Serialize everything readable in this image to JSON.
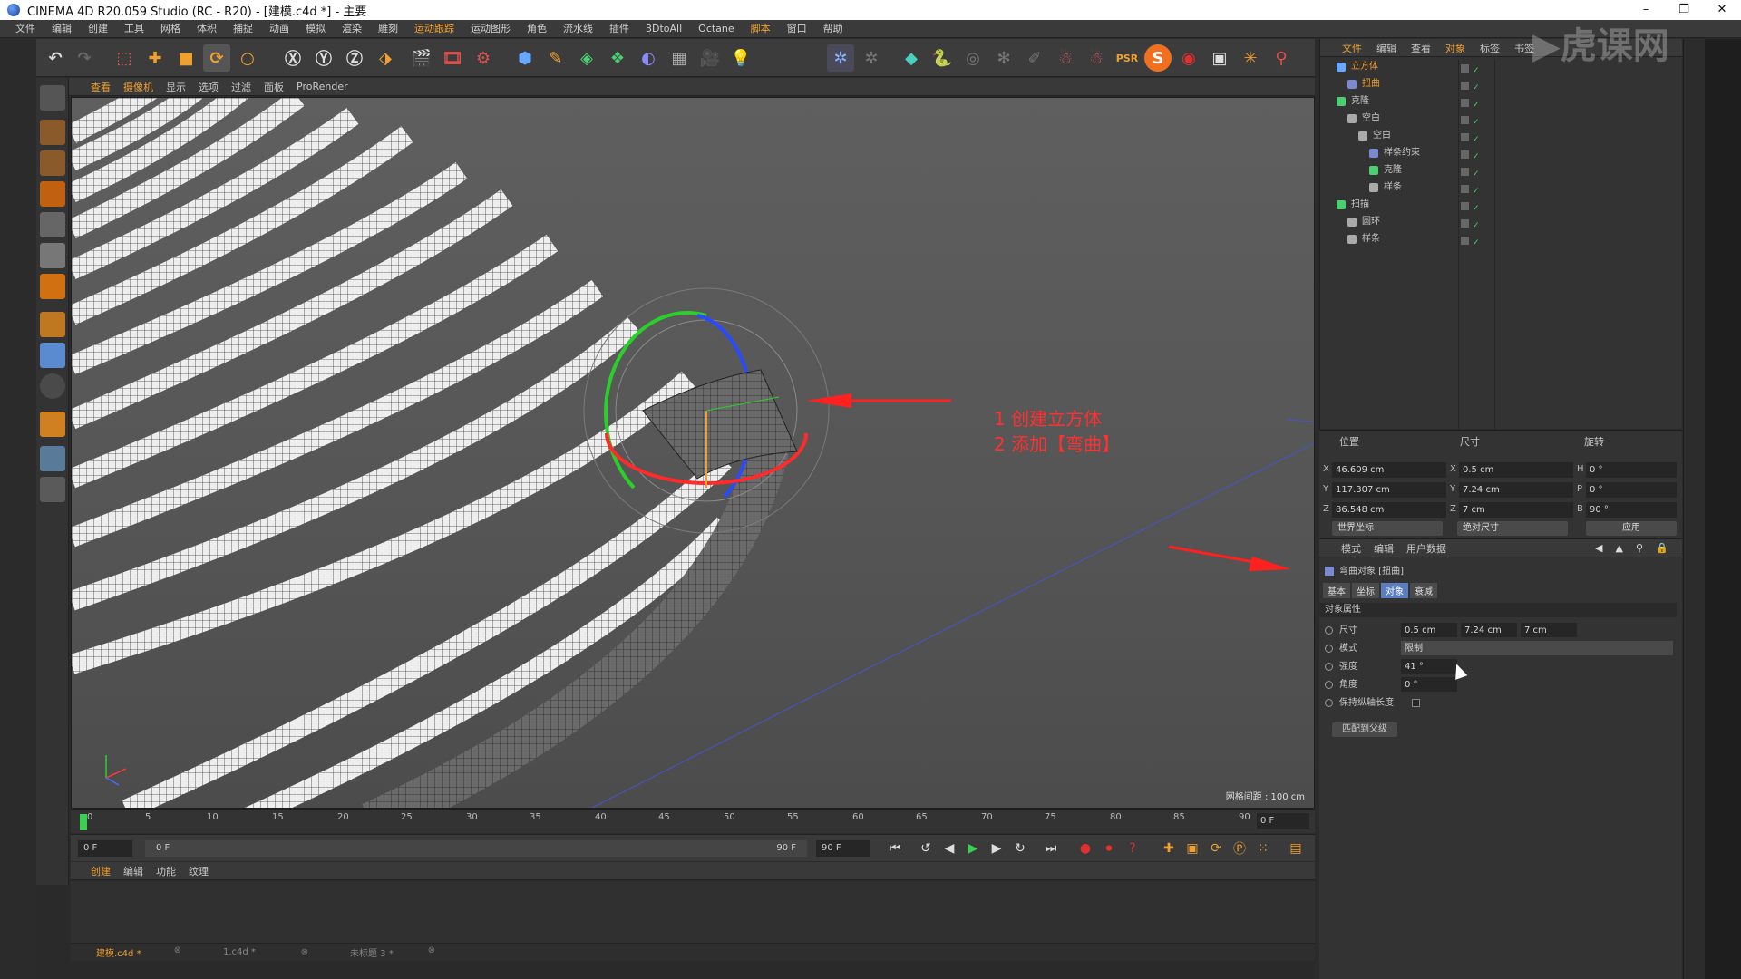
{
  "window": {
    "title": "CINEMA 4D R20.059 Studio (RC - R20) - [建模.c4d *] - 主要",
    "controls": [
      "–",
      "❐",
      "✕"
    ]
  },
  "menu": [
    "文件",
    "编辑",
    "创建",
    "工具",
    "网格",
    "体积",
    "捕捉",
    "动画",
    "模拟",
    "渲染",
    "雕刻",
    "运动跟踪",
    "运动图形",
    "角色",
    "流水线",
    "插件",
    "3DtoAll",
    "Octane",
    "脚本",
    "窗口",
    "帮助"
  ],
  "viewport": {
    "menu": [
      "查看",
      "摄像机",
      "显示",
      "选项",
      "过滤",
      "面板",
      "ProRender"
    ],
    "grid_label": "网格间距 : 100 cm",
    "annotation_line1": "1 创建立方体",
    "annotation_line2": "2 添加【弯曲】"
  },
  "timeline": {
    "ticks": [
      "0",
      "5",
      "10",
      "15",
      "20",
      "25",
      "30",
      "35",
      "40",
      "45",
      "50",
      "55",
      "60",
      "65",
      "70",
      "75",
      "80",
      "85",
      "90"
    ],
    "current_frame": "0 F"
  },
  "playbar": {
    "start": "0 F",
    "range_start": "0 F",
    "range_end": "90 F",
    "end": "90 F"
  },
  "material_panel": {
    "menu": [
      "创建",
      "编辑",
      "功能",
      "纹理"
    ]
  },
  "file_tabs": [
    {
      "label": "建模.c4d *"
    },
    {
      "label": "1.c4d *"
    },
    {
      "label": "未标题 3 *"
    }
  ],
  "object_manager": {
    "menu": [
      "文件",
      "编辑",
      "查看",
      "对象",
      "标签",
      "书签"
    ],
    "tree": [
      {
        "label": "立方体",
        "indent": 0,
        "color": "#f0a030",
        "icon": "cube-icon",
        "selected": true
      },
      {
        "label": "扭曲",
        "indent": 1,
        "color": "#f0a030",
        "icon": "bend-deformer-icon",
        "selected": true
      },
      {
        "label": "克隆",
        "indent": 0,
        "color": "#c8c8c8",
        "icon": "cloner-icon"
      },
      {
        "label": "空白",
        "indent": 1,
        "color": "#c8c8c8",
        "icon": "null-icon"
      },
      {
        "label": "空白",
        "indent": 2,
        "color": "#c8c8c8",
        "icon": "null-icon"
      },
      {
        "label": "样条约束",
        "indent": 3,
        "color": "#c8c8c8",
        "icon": "spline-wrap-icon"
      },
      {
        "label": "克隆",
        "indent": 3,
        "color": "#c8c8c8",
        "icon": "cloner-icon"
      },
      {
        "label": "样条",
        "indent": 3,
        "color": "#c8c8c8",
        "icon": "spline-icon"
      },
      {
        "label": "扫描",
        "indent": 0,
        "color": "#c8c8c8",
        "icon": "sweep-icon"
      },
      {
        "label": "圆环",
        "indent": 1,
        "color": "#c8c8c8",
        "icon": "circle-icon"
      },
      {
        "label": "样条",
        "indent": 1,
        "color": "#c8c8c8",
        "icon": "spline-icon"
      }
    ]
  },
  "coordinates": {
    "headers": {
      "position": "位置",
      "size": "尺寸",
      "rotation": "旋转"
    },
    "rows": [
      {
        "axis": "X",
        "pos": "46.609 cm",
        "size_axis": "X",
        "size": "0.5 cm",
        "rot_axis": "H",
        "rot": "0 °"
      },
      {
        "axis": "Y",
        "pos": "117.307 cm",
        "size_axis": "Y",
        "size": "7.24 cm",
        "rot_axis": "P",
        "rot": "0 °"
      },
      {
        "axis": "Z",
        "pos": "86.548 cm",
        "size_axis": "Z",
        "size": "7 cm",
        "rot_axis": "B",
        "rot": "90 °"
      }
    ],
    "coord_mode": "世界坐标",
    "size_mode": "绝对尺寸",
    "apply": "应用"
  },
  "attributes": {
    "menu": [
      "模式",
      "编辑",
      "用户数据"
    ],
    "object_title": "弯曲对象 [扭曲]",
    "tabs": [
      {
        "label": "基本",
        "active": false
      },
      {
        "label": "坐标",
        "active": false
      },
      {
        "label": "对象",
        "active": true
      },
      {
        "label": "衰减",
        "active": false
      }
    ],
    "section": "对象属性",
    "size_label": "尺寸",
    "size_x": "0.5 cm",
    "size_y": "7.24 cm",
    "size_z": "7 cm",
    "mode_label": "模式",
    "mode_value": "限制",
    "strength_label": "强度",
    "strength_value": "41 °",
    "angle_label": "角度",
    "angle_value": "0 °",
    "keep_length_label": "保持纵轴长度",
    "fit_parent": "匹配到父级"
  },
  "colors": {
    "accent": "#f0a030",
    "annotation": "#ff3030",
    "active_tab": "#5a7ec0"
  }
}
